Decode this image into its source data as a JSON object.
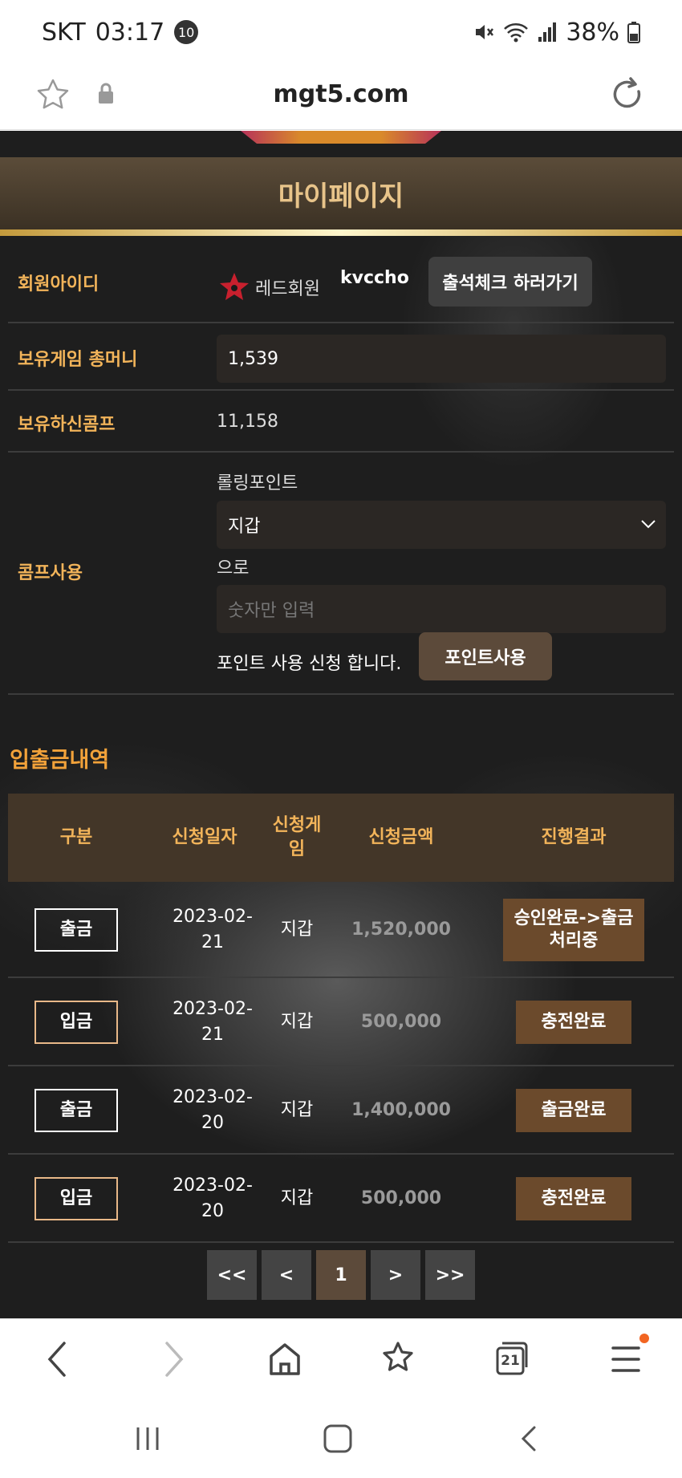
{
  "status_bar": {
    "carrier": "SKT",
    "time": "03:17",
    "notification_count": "10",
    "battery": "38%"
  },
  "browser": {
    "url": "mgt5.com"
  },
  "page": {
    "title": "마이페이지"
  },
  "member": {
    "id_label": "회원아이디",
    "rank_name": "레드회원",
    "user_id": "kvccho",
    "attend_button": "출석체크 하러가기",
    "money_label": "보유게임 총머니",
    "money_value": "1,539",
    "comp_label": "보유하신콤프",
    "comp_value": "11,158"
  },
  "comp_use": {
    "label": "콤프사용",
    "rolling_point_label": "롤링포인트",
    "target_selected": "지갑",
    "to_text": "으로",
    "amount_placeholder": "숫자만 입력",
    "request_text": "포인트 사용 신청 합니다.",
    "use_button": "포인트사용"
  },
  "history": {
    "title": "입출금내역",
    "columns": [
      "구분",
      "신청일자",
      "신청게임",
      "신청금액",
      "진행결과"
    ],
    "rows": [
      {
        "type": "출금",
        "date": "2023-02-21",
        "game": "지갑",
        "amount": "1,520,000",
        "result": "승인완료->출금처리중"
      },
      {
        "type": "입금",
        "date": "2023-02-21",
        "game": "지갑",
        "amount": "500,000",
        "result": "충전완료"
      },
      {
        "type": "출금",
        "date": "2023-02-20",
        "game": "지갑",
        "amount": "1,400,000",
        "result": "출금완료"
      },
      {
        "type": "입금",
        "date": "2023-02-20",
        "game": "지갑",
        "amount": "500,000",
        "result": "충전완료"
      }
    ]
  },
  "pagination": {
    "first": "<<",
    "prev": "<",
    "current": "1",
    "next": ">",
    "last": ">>"
  },
  "toolbar": {
    "tabs_count": "21"
  },
  "colors": {
    "accent_gold": "#f2b45a",
    "title_text": "#e8c48a",
    "result_button": "#6b4a2c",
    "notification_dot": "#f26522"
  }
}
